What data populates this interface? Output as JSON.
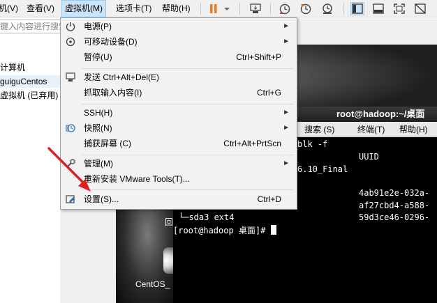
{
  "menubar": {
    "items": [
      {
        "label": "虚拟机(V)"
      },
      {
        "label": "查看(V)"
      },
      {
        "label": "虚拟机(M)"
      },
      {
        "label": "选项卡(T)"
      },
      {
        "label": "帮助(H)"
      }
    ],
    "icons": [
      "pause-icon",
      "dropdown-arrow-icon",
      "send-keys-icon",
      "snapshot-icon",
      "revert-snapshot-icon",
      "snapshot-manager-icon",
      "console-view-icon",
      "thumbnail-view-icon",
      "fullscreen-icon",
      "unity-icon"
    ]
  },
  "library": {
    "search_placeholder": "键入内容进行搜索",
    "items": [
      {
        "label": "计算机"
      },
      {
        "label": "guiguCentos"
      },
      {
        "label": "虚拟机 (已弃用)"
      }
    ]
  },
  "vm_menu": {
    "items": [
      {
        "label": "电源(P)",
        "shortcut": "",
        "submenu": true,
        "icon": "power-icon"
      },
      {
        "label": "可移动设备(D)",
        "shortcut": "",
        "submenu": true,
        "icon": "removable-devices-icon"
      },
      {
        "label": "暂停(U)",
        "shortcut": "Ctrl+Shift+P",
        "submenu": false,
        "icon": ""
      },
      {
        "label": "发送 Ctrl+Alt+Del(E)",
        "shortcut": "",
        "submenu": false,
        "icon": "send-ctrl-alt-del-icon"
      },
      {
        "label": "抓取输入内容(I)",
        "shortcut": "Ctrl+G",
        "submenu": false,
        "icon": ""
      },
      {
        "label": "SSH(H)",
        "shortcut": "",
        "submenu": true,
        "icon": ""
      },
      {
        "label": "快照(N)",
        "shortcut": "",
        "submenu": true,
        "icon": "snapshot-icon"
      },
      {
        "label": "捕获屏幕 (C)",
        "shortcut": "Ctrl+Alt+PrtScn",
        "submenu": false,
        "icon": ""
      },
      {
        "label": "管理(M)",
        "shortcut": "",
        "submenu": true,
        "icon": "manage-wrench-icon"
      },
      {
        "label": "重新安装 VMware Tools(T)...",
        "shortcut": "",
        "submenu": false,
        "icon": ""
      },
      {
        "label": "设置(S)...",
        "shortcut": "Ctrl+D",
        "submenu": false,
        "icon": "settings-icon"
      }
    ]
  },
  "terminal": {
    "title": "root@hadoop:~/桌面",
    "menu": [
      "搜索 (S)",
      "终端(T)",
      "帮助(H)"
    ],
    "lines": {
      "cmd": "blk -f",
      "uuid_header": "UUID",
      "final": "6.10_Final",
      "uuid1": "4ab91e2e-032a-",
      "uuid2": "af27cbd4-a588-",
      "uuid3": "59d3ce46-0296-",
      "sda3": "└─sda3 ext4",
      "prompt": "[root@hadoop 桌面]# "
    },
    "left_char": "回"
  },
  "desktop": {
    "centos_label": "CentOS_"
  },
  "colors": {
    "menu_bg": "#f2f2f2",
    "highlight": "#cce4f7",
    "annotation_arrow": "#e02020",
    "pause_orange": "#f07a1a"
  }
}
